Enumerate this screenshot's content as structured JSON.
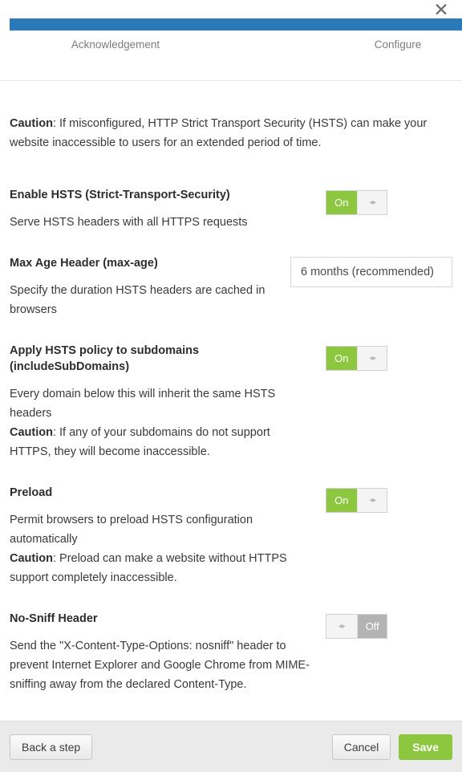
{
  "header": {
    "close_icon": "close-icon",
    "progress_percent": 100,
    "steps": [
      {
        "label": "Acknowledgement"
      },
      {
        "label": "Configure"
      }
    ]
  },
  "body": {
    "intro": {
      "label": "Caution",
      "text": ": If misconfigured, HTTP Strict Transport Security (HSTS) can make your website inaccessible to users for an extended period of time."
    },
    "settings": [
      {
        "title": "Enable HSTS (Strict-Transport-Security)",
        "desc": "Serve HSTS headers with all HTTPS requests",
        "control": "toggle",
        "state": "On",
        "handle_icon": "left-right-arrow-icon"
      },
      {
        "title": "Max Age Header (max-age)",
        "desc": "Specify the duration HSTS headers are cached in browsers",
        "control": "select",
        "value": "6 months (recommended)"
      },
      {
        "title": "Apply HSTS policy to subdomains (includeSubDomains)",
        "desc": "Every domain below this will inherit the same HSTS headers",
        "caution_label": "Caution",
        "caution_text": ": If any of your subdomains do not support HTTPS, they will become inaccessible.",
        "control": "toggle",
        "state": "On",
        "handle_icon": "left-right-arrow-icon"
      },
      {
        "title": "Preload",
        "desc": "Permit browsers to preload HSTS configuration automatically",
        "caution_label": "Caution",
        "caution_text": ": Preload can make a website without HTTPS support completely inaccessible.",
        "control": "toggle",
        "state": "On",
        "handle_icon": "left-right-arrow-icon"
      },
      {
        "title": "No-Sniff Header",
        "desc": "Send the \"X-Content-Type-Options: nosniff\" header to prevent Internet Explorer and Google Chrome from MIME-sniffing away from the declared Content-Type.",
        "control": "toggle",
        "state": "Off",
        "handle_icon": "left-right-arrow-icon"
      }
    ]
  },
  "footer": {
    "back_label": "Back a step",
    "cancel_label": "Cancel",
    "save_label": "Save"
  },
  "colors": {
    "progress": "#2a7ab9",
    "toggle_on": "#8dc63f",
    "toggle_off": "#b3b3b3",
    "save": "#8dc63f",
    "footer_bg": "#eaeaea"
  }
}
